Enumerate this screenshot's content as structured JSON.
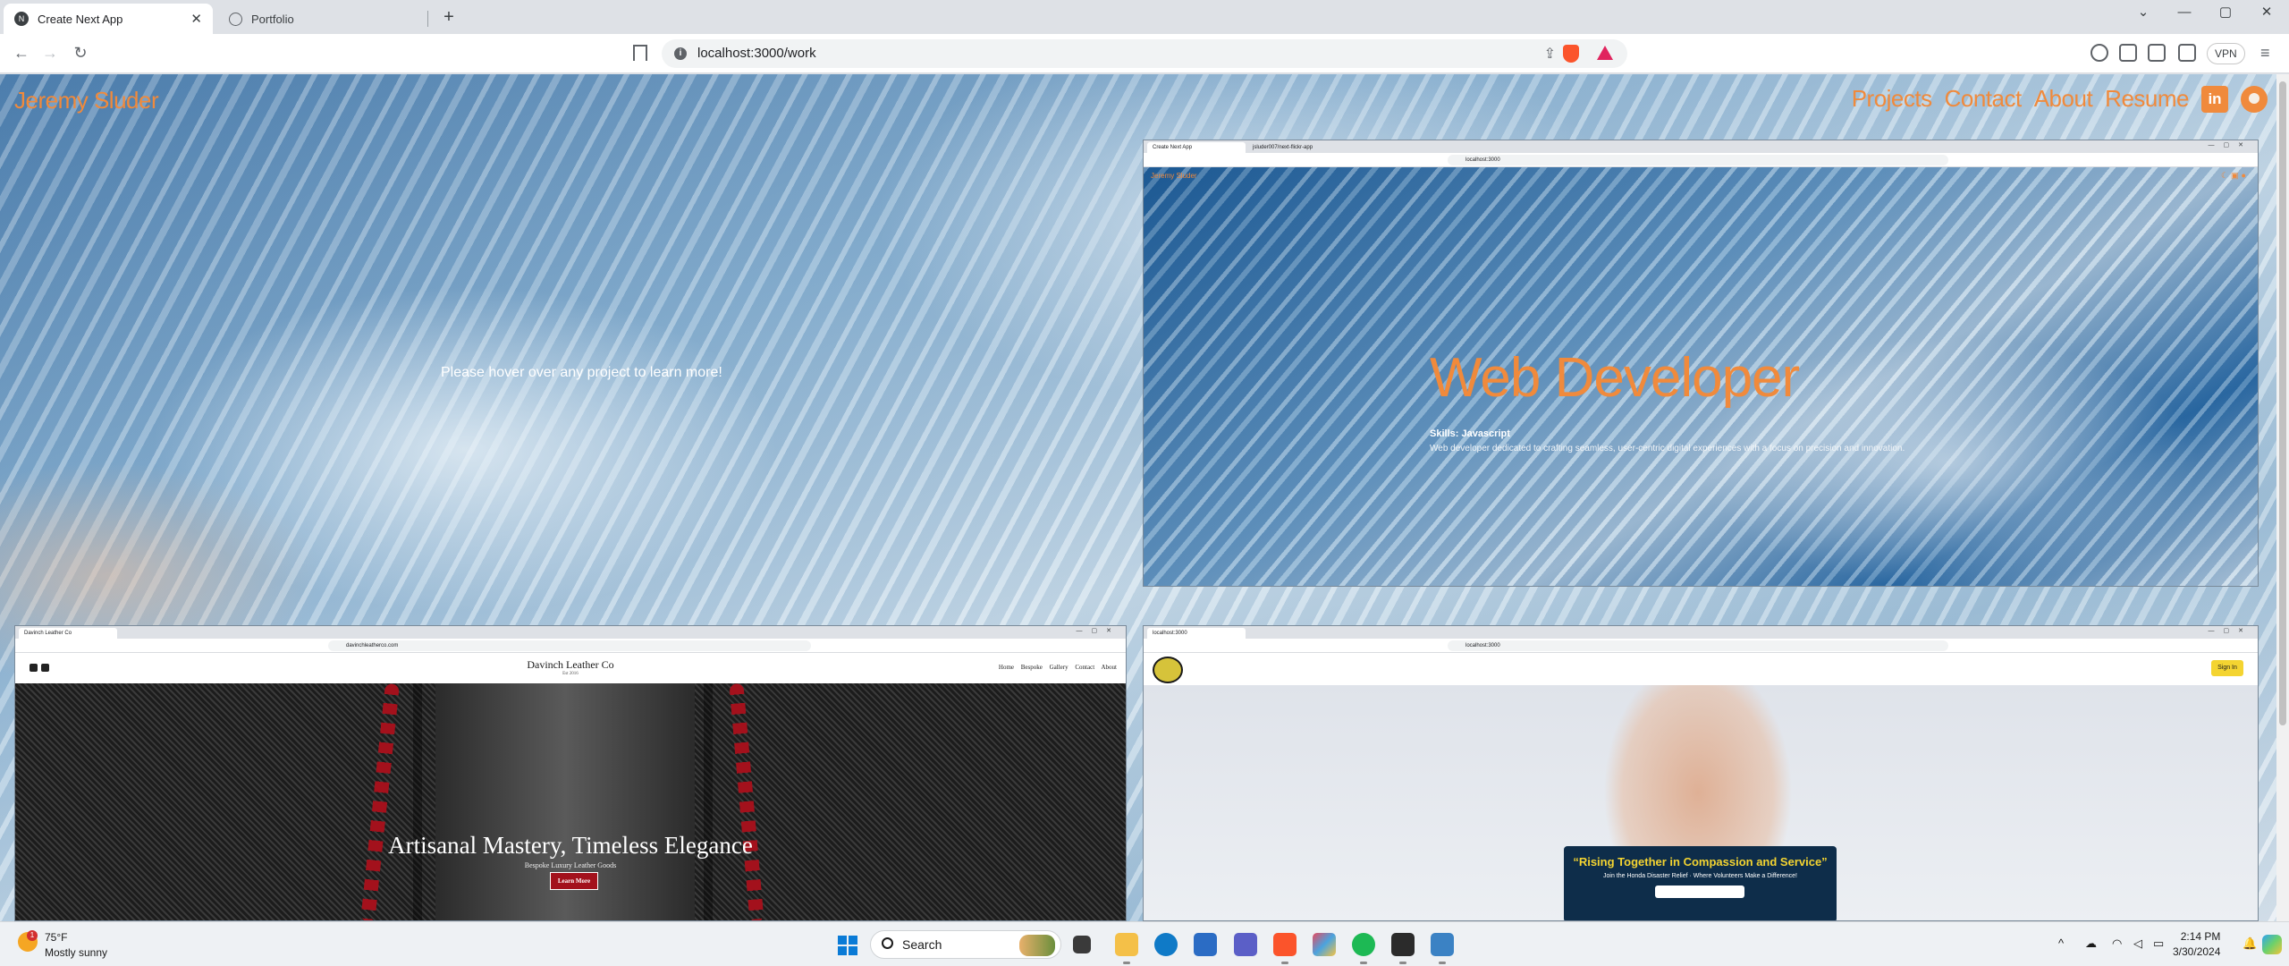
{
  "browser": {
    "tabs": [
      {
        "label": "Create Next App",
        "active": true
      },
      {
        "label": "Portfolio",
        "active": false
      }
    ],
    "address": "localhost:3000/work",
    "vpn_label": "VPN",
    "window_controls": {
      "minimize": "—",
      "maximize": "▢",
      "close": "✕",
      "tab_list": "⌄"
    }
  },
  "site": {
    "title": "Jeremy Sluder",
    "nav": [
      "Projects",
      "Contact",
      "About",
      "Resume"
    ],
    "linkedin_label": "in",
    "hover_message": "Please hover over any project to learn more!"
  },
  "projects": {
    "web_developer": {
      "tabs": [
        "Create Next App",
        "jsluder007/next-flickr-app"
      ],
      "address": "localhost:3000",
      "mini_title": "Jeremy Sluder",
      "headline": "Web Developer",
      "skills": "Skills: Javascript",
      "description": "Web developer dedicated to crafting seamless, user-centric digital experiences with a focus on precision and innovation."
    },
    "davinch": {
      "tabs": [
        "Davinch Leather Co"
      ],
      "address": "davinchleatherco.com",
      "brand": "Davinch Leather Co",
      "brand_sub": "Est 2016",
      "nav": "Home Bespoke Gallery Contact About",
      "hero_title": "Artisanal Mastery, Timeless Elegance",
      "hero_sub": "Bespoke Luxury Leather Goods",
      "button": "Learn More"
    },
    "honda": {
      "tabs": [
        "localhost:3000"
      ],
      "address": "localhost:3000",
      "signin": "Sign In",
      "banner_title": "“Rising Together in Compassion and Service”",
      "banner_sub": "Join the Honda Disaster Relief · Where Volunteers Make a Difference!"
    }
  },
  "taskbar": {
    "weather_badge": "1",
    "temperature": "75°F",
    "condition": "Mostly sunny",
    "search_label": "Search",
    "time": "2:14 PM",
    "date": "3/30/2024",
    "colors": {
      "windows": "#0a7bd6",
      "brave": "#fb542b",
      "spotify": "#1db954",
      "teams": "#5b5fc7",
      "edge": "#0f7ac7",
      "explorer": "#f4c048",
      "store": "#2b6cc4"
    }
  }
}
